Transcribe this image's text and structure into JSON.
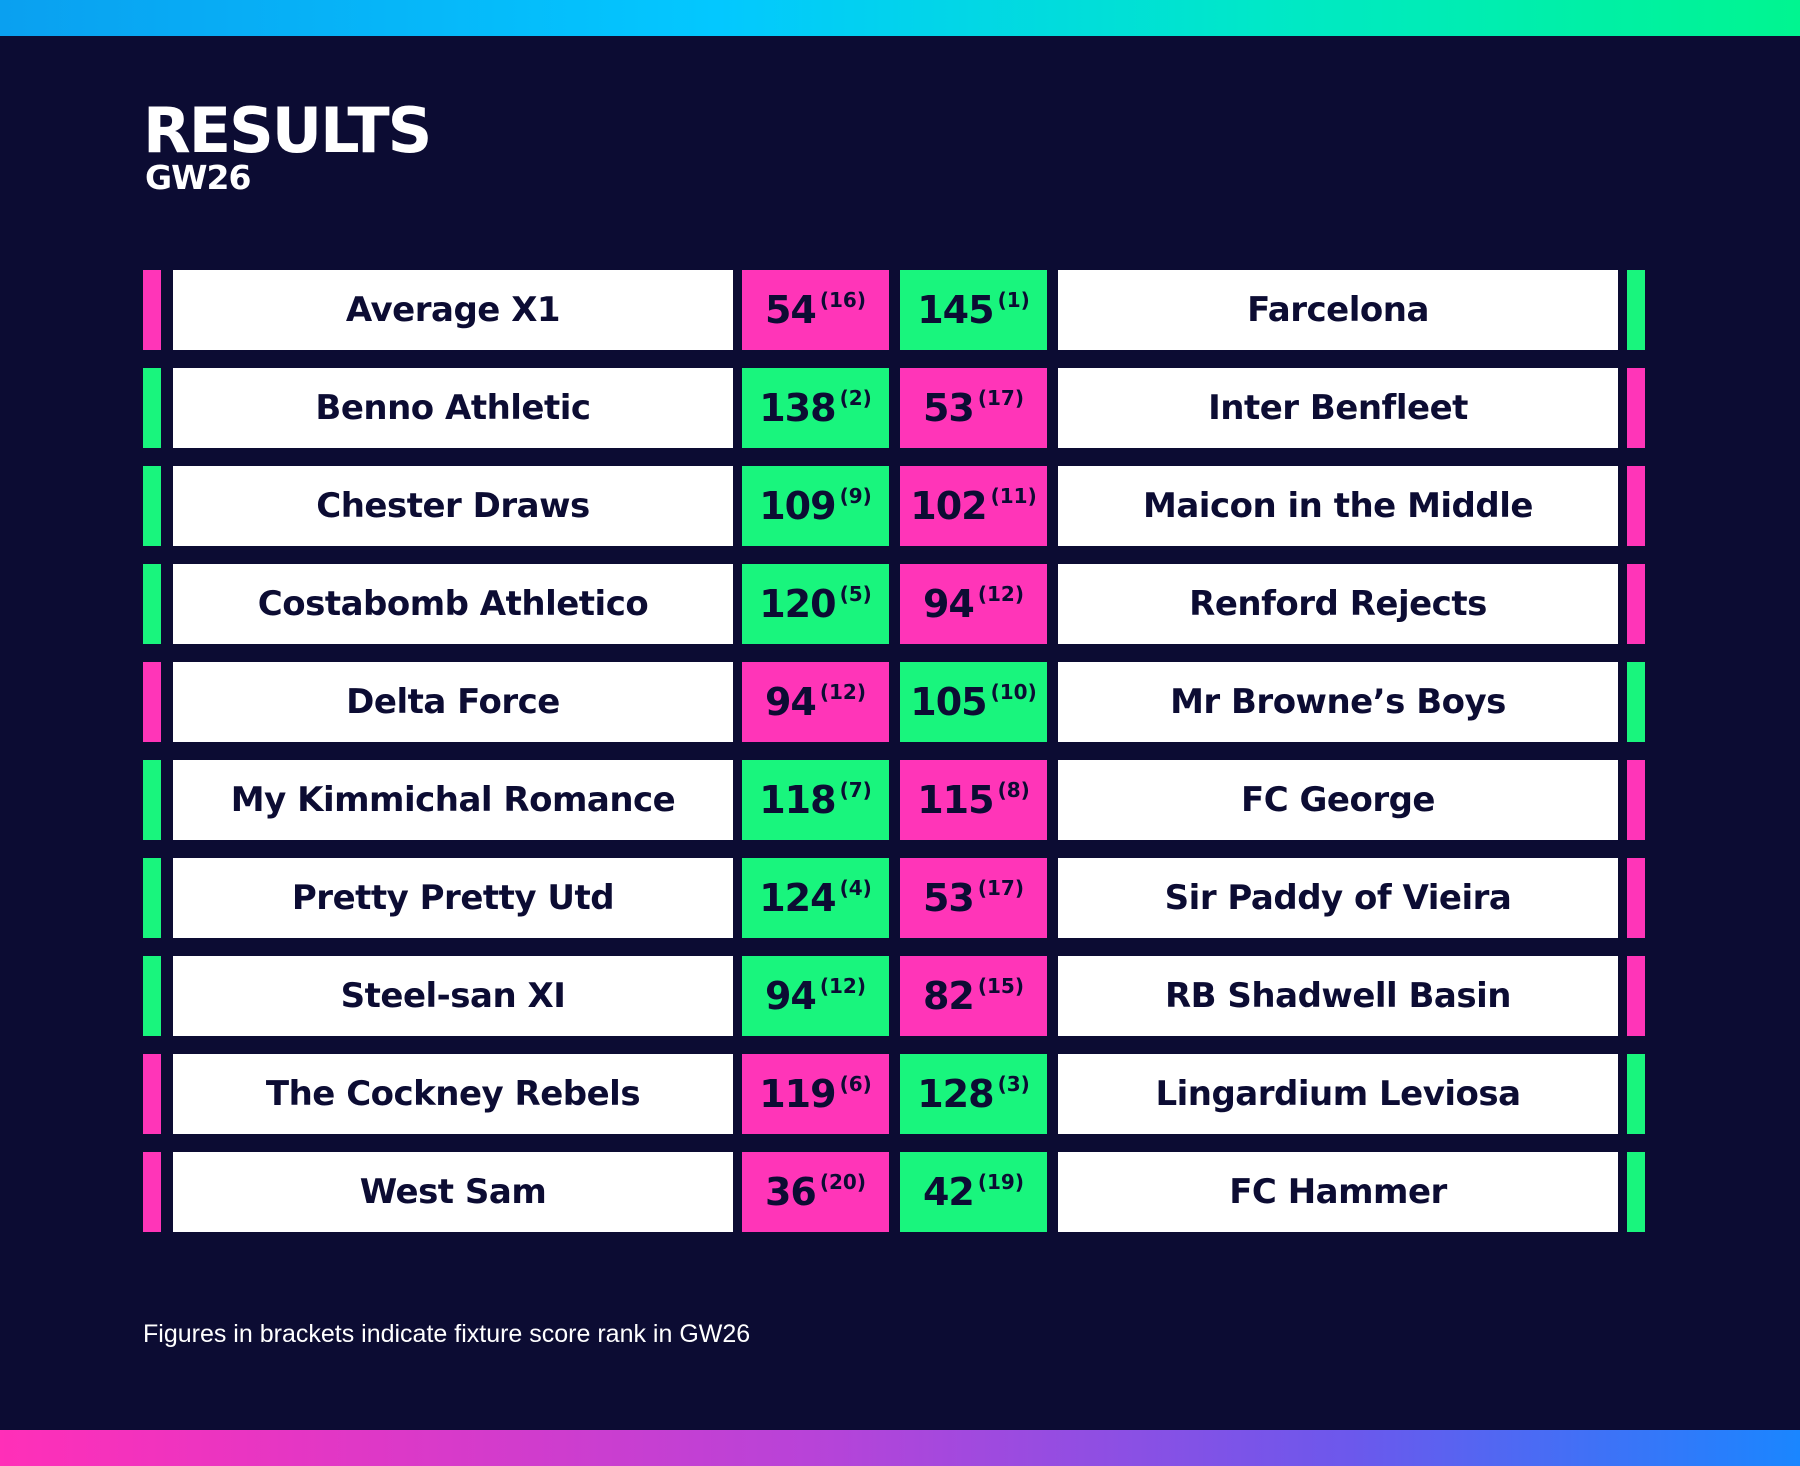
{
  "header": {
    "title": "RESULTS",
    "subtitle": "GW26"
  },
  "colors": {
    "win": "#19f57d",
    "loss": "#ff35b8",
    "background": "#0c0c33",
    "name_box": "#ffffff"
  },
  "fixtures": [
    {
      "home": {
        "team": "Average X1",
        "score": "54",
        "rank": "(16)",
        "result": "loss"
      },
      "away": {
        "team": "Farcelona",
        "score": "145",
        "rank": "(1)",
        "result": "win"
      }
    },
    {
      "home": {
        "team": "Benno Athletic",
        "score": "138",
        "rank": "(2)",
        "result": "win"
      },
      "away": {
        "team": "Inter Benfleet",
        "score": "53",
        "rank": "(17)",
        "result": "loss"
      }
    },
    {
      "home": {
        "team": "Chester Draws",
        "score": "109",
        "rank": "(9)",
        "result": "win"
      },
      "away": {
        "team": "Maicon in the Middle",
        "score": "102",
        "rank": "(11)",
        "result": "loss"
      }
    },
    {
      "home": {
        "team": "Costabomb Athletico",
        "score": "120",
        "rank": "(5)",
        "result": "win"
      },
      "away": {
        "team": "Renford Rejects",
        "score": "94",
        "rank": "(12)",
        "result": "loss"
      }
    },
    {
      "home": {
        "team": "Delta Force",
        "score": "94",
        "rank": "(12)",
        "result": "loss"
      },
      "away": {
        "team": "Mr Browne’s Boys",
        "score": "105",
        "rank": "(10)",
        "result": "win"
      }
    },
    {
      "home": {
        "team": "My Kimmichal Romance",
        "score": "118",
        "rank": "(7)",
        "result": "win"
      },
      "away": {
        "team": "FC George",
        "score": "115",
        "rank": "(8)",
        "result": "loss"
      }
    },
    {
      "home": {
        "team": "Pretty Pretty Utd",
        "score": "124",
        "rank": "(4)",
        "result": "win"
      },
      "away": {
        "team": "Sir Paddy of Vieira",
        "score": "53",
        "rank": "(17)",
        "result": "loss"
      }
    },
    {
      "home": {
        "team": "Steel-san XI",
        "score": "94",
        "rank": "(12)",
        "result": "win"
      },
      "away": {
        "team": "RB Shadwell Basin",
        "score": "82",
        "rank": "(15)",
        "result": "loss"
      }
    },
    {
      "home": {
        "team": "The Cockney Rebels",
        "score": "119",
        "rank": "(6)",
        "result": "loss"
      },
      "away": {
        "team": "Lingardium Leviosa",
        "score": "128",
        "rank": "(3)",
        "result": "win"
      }
    },
    {
      "home": {
        "team": "West Sam",
        "score": "36",
        "rank": "(20)",
        "result": "loss"
      },
      "away": {
        "team": "FC Hammer",
        "score": "42",
        "rank": "(19)",
        "result": "win"
      }
    }
  ],
  "footer": {
    "note": "Figures in brackets indicate fixture score rank in GW26"
  }
}
